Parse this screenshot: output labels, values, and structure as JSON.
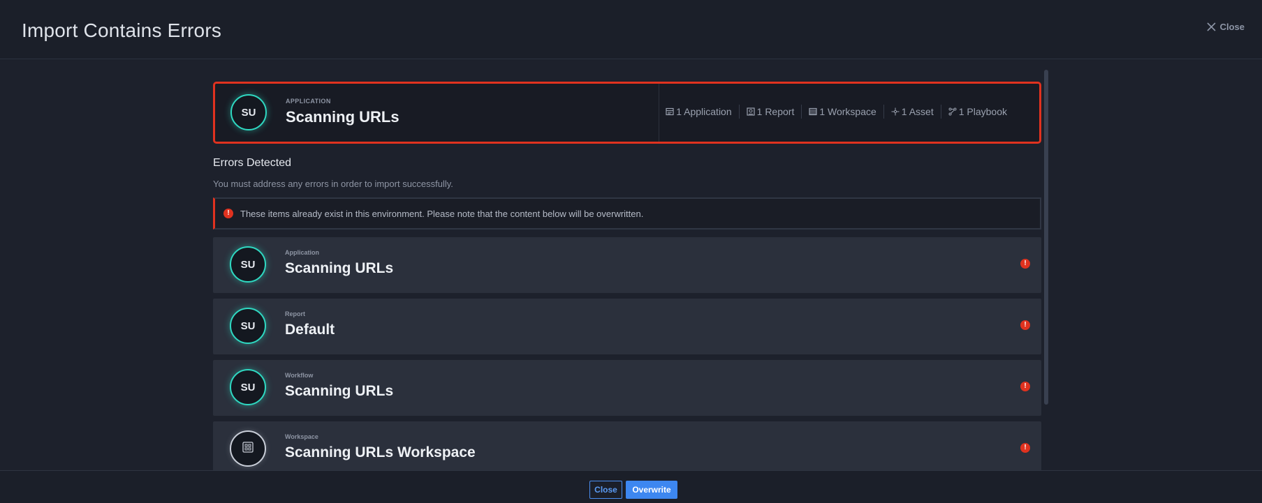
{
  "header": {
    "title": "Import Contains Errors",
    "close_label": "Close"
  },
  "summary": {
    "avatar": "SU",
    "type": "APPLICATION",
    "name": "Scanning URLs",
    "counts": [
      {
        "icon": "application-icon",
        "label": "1 Application"
      },
      {
        "icon": "report-icon",
        "label": "1 Report"
      },
      {
        "icon": "workspace-icon",
        "label": "1 Workspace"
      },
      {
        "icon": "asset-icon",
        "label": "1 Asset"
      },
      {
        "icon": "playbook-icon",
        "label": "1 Playbook"
      }
    ]
  },
  "errors": {
    "title": "Errors Detected",
    "subtitle": "You must address any errors in order to import successfully.",
    "alert": "These items already exist in this environment. Please note that the content below will be overwritten."
  },
  "items": [
    {
      "avatar": "SU",
      "type": "Application",
      "name": "Scanning URLs"
    },
    {
      "avatar": "SU",
      "type": "Report",
      "name": "Default"
    },
    {
      "avatar": "SU",
      "type": "Workflow",
      "name": "Scanning URLs"
    },
    {
      "avatar": "",
      "avatar_icon": "workspace-icon",
      "type": "Workspace",
      "name": "Scanning URLs Workspace"
    }
  ],
  "footer": {
    "close_label": "Close",
    "overwrite_label": "Overwrite"
  },
  "colors": {
    "accent_blue": "#3d87f0",
    "error_red": "#e0321f",
    "avatar_ring": "#2fd9c2"
  }
}
